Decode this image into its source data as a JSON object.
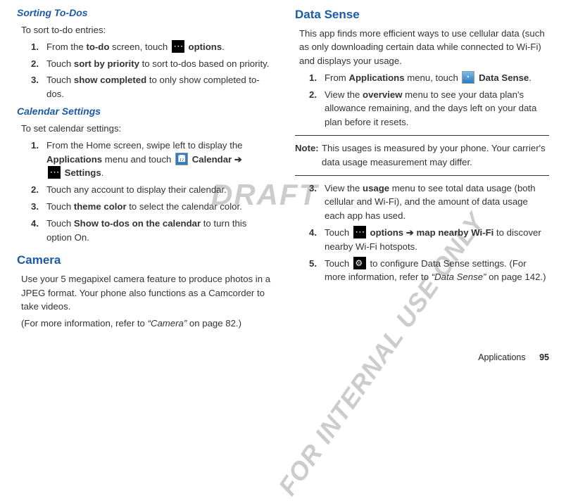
{
  "watermark": {
    "text1": "DRAFT",
    "text2": "FOR INTERNAL USE ONLY"
  },
  "col1": {
    "sorting_heading": "Sorting To-Dos",
    "sorting_intro": "To sort to-do entries:",
    "sorting_items": [
      {
        "num": "1.",
        "prefix": "From the ",
        "bold1": "to-do",
        "mid": " screen, touch ",
        "icon": "more",
        "bold2": " options",
        "suffix": "."
      },
      {
        "num": "2.",
        "prefix": "Touch ",
        "bold1": "sort by priority",
        "suffix": " to sort to-dos based on priority."
      },
      {
        "num": "3.",
        "prefix": "Touch ",
        "bold1": "show completed",
        "suffix": " to only show completed to-dos."
      }
    ],
    "cal_heading": "Calendar Settings",
    "cal_intro": "To set calendar settings:",
    "cal_items": [
      {
        "num": "1.",
        "line1_pre": "From the Home screen, swipe left to display the ",
        "line1_bold": "Applications",
        "line1_mid": " menu and touch ",
        "icon": "calendar",
        "line1_bold2": " Calendar",
        "arrow": " ➔",
        "icon2": "more",
        "line1_bold3": " Settings",
        "suffix": "."
      },
      {
        "num": "2.",
        "text": "Touch any account to display their calendar."
      },
      {
        "num": "3.",
        "prefix": "Touch ",
        "bold1": "theme color",
        "suffix": " to select the calendar color."
      },
      {
        "num": "4.",
        "prefix": "Touch ",
        "bold1": "Show to-dos on the calendar",
        "suffix": " to turn this option On."
      }
    ],
    "camera_heading": "Camera",
    "camera_p1": "Use your 5 megapixel camera feature to produce photos in a JPEG format. Your phone also functions as a Camcorder to take videos.",
    "camera_p2_pre": "(For more information, refer to ",
    "camera_p2_ital": "“Camera”",
    "camera_p2_suf": " on page 82.)"
  },
  "col2": {
    "ds_heading": "Data Sense",
    "ds_p1": "This app finds more efficient ways to use cellular data (such as only downloading certain data while connected to Wi-Fi) and displays your usage.",
    "ds_items_a": [
      {
        "num": "1.",
        "prefix": "From ",
        "bold1": "Applications",
        "mid": " menu, touch ",
        "icon": "datasense",
        "bold2": " Data Sense",
        "suffix": "."
      },
      {
        "num": "2.",
        "prefix": "View the ",
        "bold1": "overview",
        "suffix": " menu to see your data plan's allowance remaining, and the days left on your data plan before it resets."
      }
    ],
    "note_label": "Note:",
    "note_text": "This usages is measured by your phone. Your carrier's data usage measurement may differ.",
    "ds_items_b": [
      {
        "num": "3.",
        "prefix": "View the ",
        "bold1": "usage",
        "suffix": " menu to see total data usage (both cellular and Wi-Fi), and the amount of data usage each app has used."
      },
      {
        "num": "4.",
        "prefix": "Touch ",
        "icon": "more",
        "bold1": " options ",
        "arrow": "➔",
        "bold2": " map nearby Wi-Fi",
        "suffix": " to discover nearby Wi-Fi hotspots."
      },
      {
        "num": "5.",
        "prefix": "Touch ",
        "icon": "gear",
        "mid": " to configure Data Sense settings. (For more information, refer to ",
        "ital": "“Data Sense”",
        "suffix": " on page 142.)"
      }
    ]
  },
  "footer": {
    "label": "Applications",
    "page": "95"
  }
}
